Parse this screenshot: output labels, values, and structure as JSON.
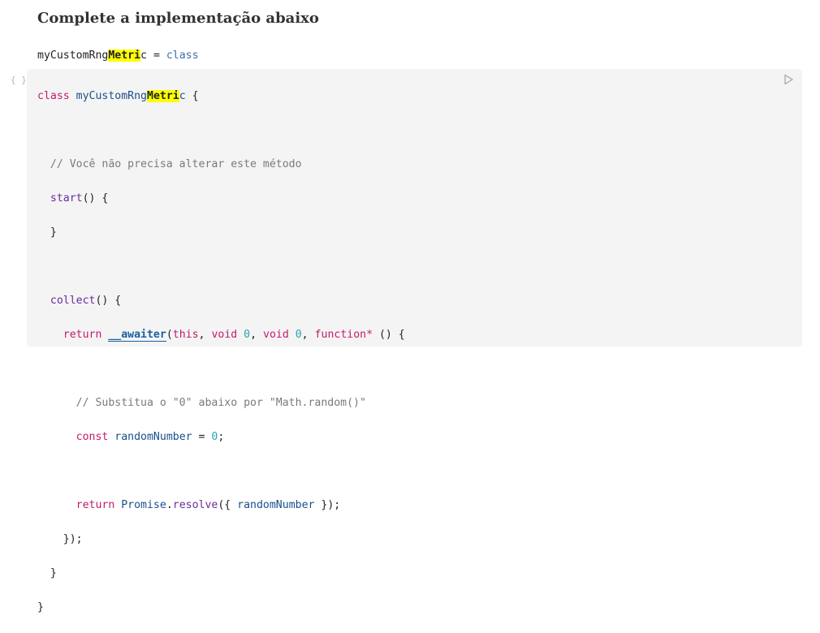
{
  "heading": "Complete a implementação abaixo",
  "summary": {
    "name_before": "myCustomRng",
    "name_highlight": "Metri",
    "name_after": "c",
    "equals": " = ",
    "value": "class"
  },
  "code": {
    "line1": {
      "kw": "class",
      "name_before": "myCustomRng",
      "name_highlight": "Metri",
      "name_after": "c",
      "rest": " {"
    },
    "line3": {
      "comment": "// Você não precisa alterar este método"
    },
    "line4": {
      "fn": "start",
      "rest": "() {"
    },
    "line5": {
      "text": "}"
    },
    "line7": {
      "fn": "collect",
      "rest": "() {"
    },
    "line8": {
      "kw_return": "return",
      "awaiter": "__awaiter",
      "open": "(",
      "this_kw": "this",
      "sep1": ", ",
      "void1": "void",
      "zero1": "0",
      "sep2": ", ",
      "void2": "void",
      "zero2": "0",
      "sep3": ", ",
      "function_kw": "function*",
      "rest": " () {"
    },
    "line10": {
      "comment_a": "// Substitua o ",
      "str1": "\"0\"",
      "comment_b": " abaixo por ",
      "str2": "\"Math.random()\""
    },
    "line11": {
      "kw": "const",
      "var": "randomNumber",
      "eq": " = ",
      "zero": "0",
      "semi": ";"
    },
    "line13": {
      "kw": "return",
      "promise": "Promise",
      "dot": ".",
      "resolve": "resolve",
      "open": "({ ",
      "var": "randomNumber",
      "close": " });"
    },
    "line14": {
      "text": "});"
    },
    "line15": {
      "text": "}"
    },
    "line16": {
      "text": "}"
    }
  },
  "icons": {
    "toggle": "braces-icon",
    "run": "play-icon"
  }
}
